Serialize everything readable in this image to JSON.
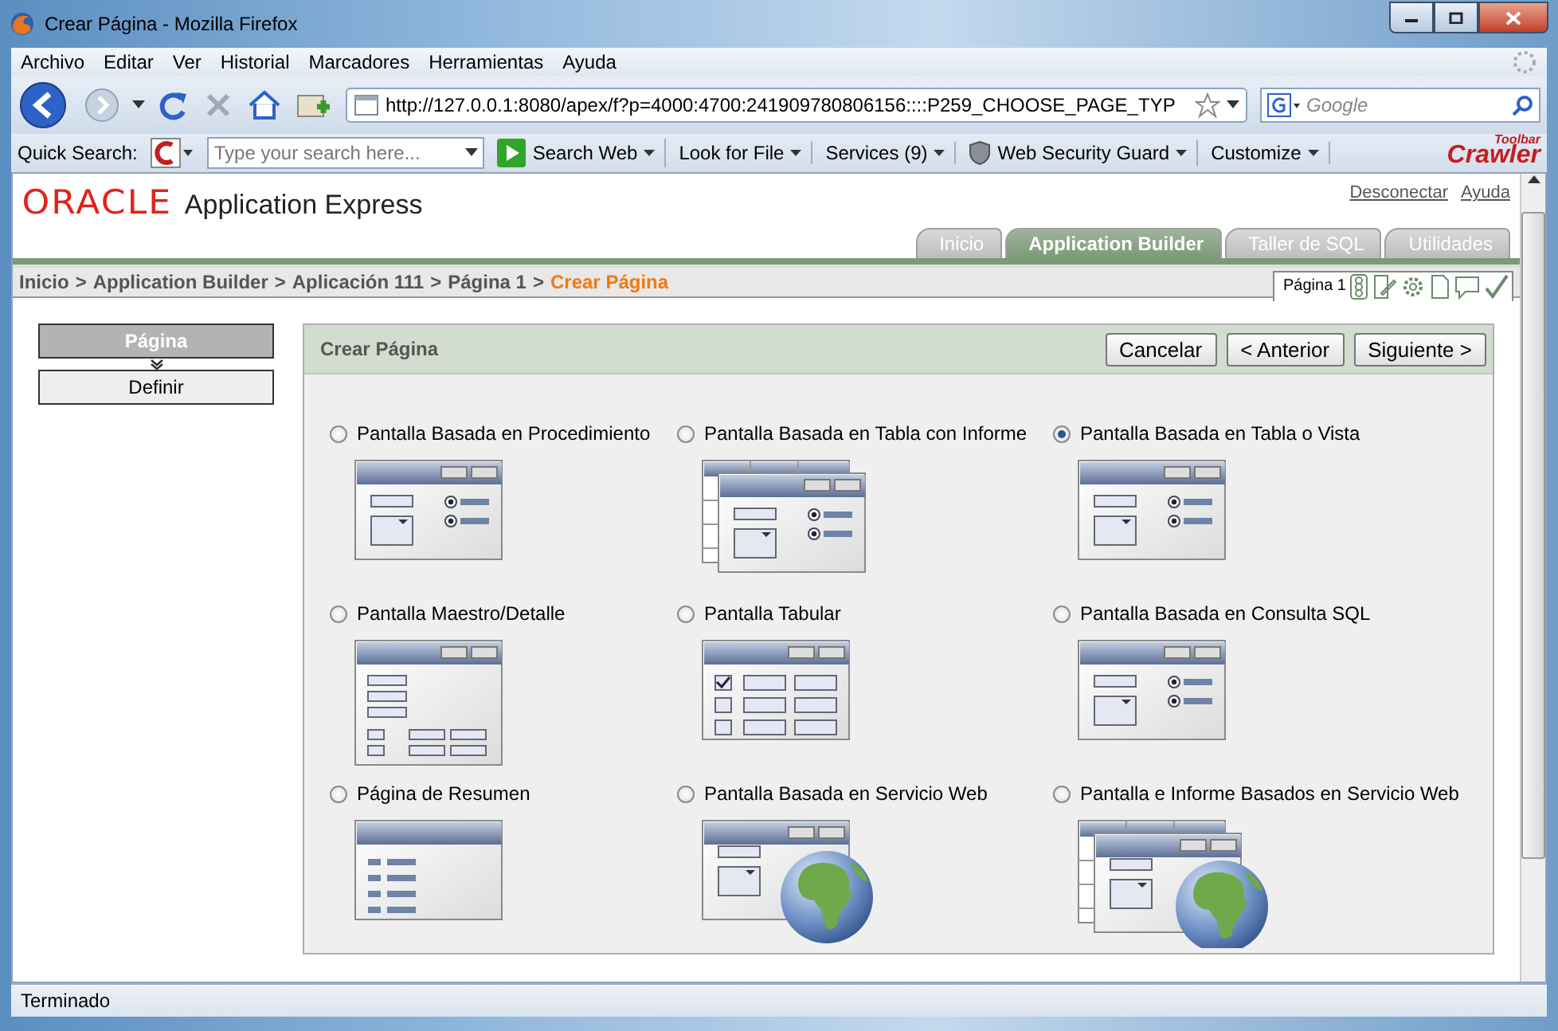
{
  "window": {
    "title": "Crear Página - Mozilla Firefox"
  },
  "menu": [
    "Archivo",
    "Editar",
    "Ver",
    "Historial",
    "Marcadores",
    "Herramientas",
    "Ayuda"
  ],
  "address": {
    "url": "http://127.0.0.1:8080/apex/f?p=4000:4700:241909780806156::::P259_CHOOSE_PAGE_TYP"
  },
  "search": {
    "placeholder": "Google"
  },
  "toolbar": {
    "label": "Quick Search:",
    "placeholder": "Type your search here...",
    "items": [
      "Search Web",
      "Look for File",
      "Services (9)",
      "Web Security Guard",
      "Customize"
    ],
    "brand": "Crawler",
    "brand_badge": "Toolbar"
  },
  "header": {
    "logo": "ORACLE",
    "product": "Application Express",
    "links": [
      "Desconectar",
      "Ayuda"
    ]
  },
  "tabs": [
    {
      "label": "Inicio",
      "selected": false
    },
    {
      "label": "Application Builder",
      "selected": true
    },
    {
      "label": "Taller de SQL",
      "selected": false
    },
    {
      "label": "Utilidades",
      "selected": false
    }
  ],
  "breadcrumb": {
    "items": [
      "Inicio",
      "Application Builder",
      "Aplicación 111",
      "Página 1"
    ],
    "separator": ">",
    "current": "Crear Página"
  },
  "page_tools": {
    "label": "Página 1"
  },
  "wizard": {
    "steps": [
      {
        "label": "Página",
        "selected": true
      },
      {
        "label": "Definir",
        "selected": false
      }
    ]
  },
  "region": {
    "title": "Crear Página",
    "buttons": [
      "Cancelar",
      "< Anterior",
      "Siguiente >"
    ]
  },
  "options": [
    {
      "label": "Pantalla Basada en Procedimiento",
      "kind": "form",
      "selected": false
    },
    {
      "label": "Pantalla Basada en Tabla con Informe",
      "kind": "report-form",
      "selected": false
    },
    {
      "label": "Pantalla Basada en Tabla o Vista",
      "kind": "form",
      "selected": true
    },
    {
      "label": "Pantalla Maestro/Detalle",
      "kind": "master-detail",
      "selected": false
    },
    {
      "label": "Pantalla Tabular",
      "kind": "tabular",
      "selected": false
    },
    {
      "label": "Pantalla Basada en Consulta SQL",
      "kind": "form",
      "selected": false
    },
    {
      "label": "Página de Resumen",
      "kind": "summary",
      "selected": false
    },
    {
      "label": "Pantalla Basada en Servicio Web",
      "kind": "webservice",
      "selected": false
    },
    {
      "label": "Pantalla e Informe Basados en Servicio Web",
      "kind": "report-webservice",
      "selected": false
    }
  ],
  "status_bar": "Terminado"
}
